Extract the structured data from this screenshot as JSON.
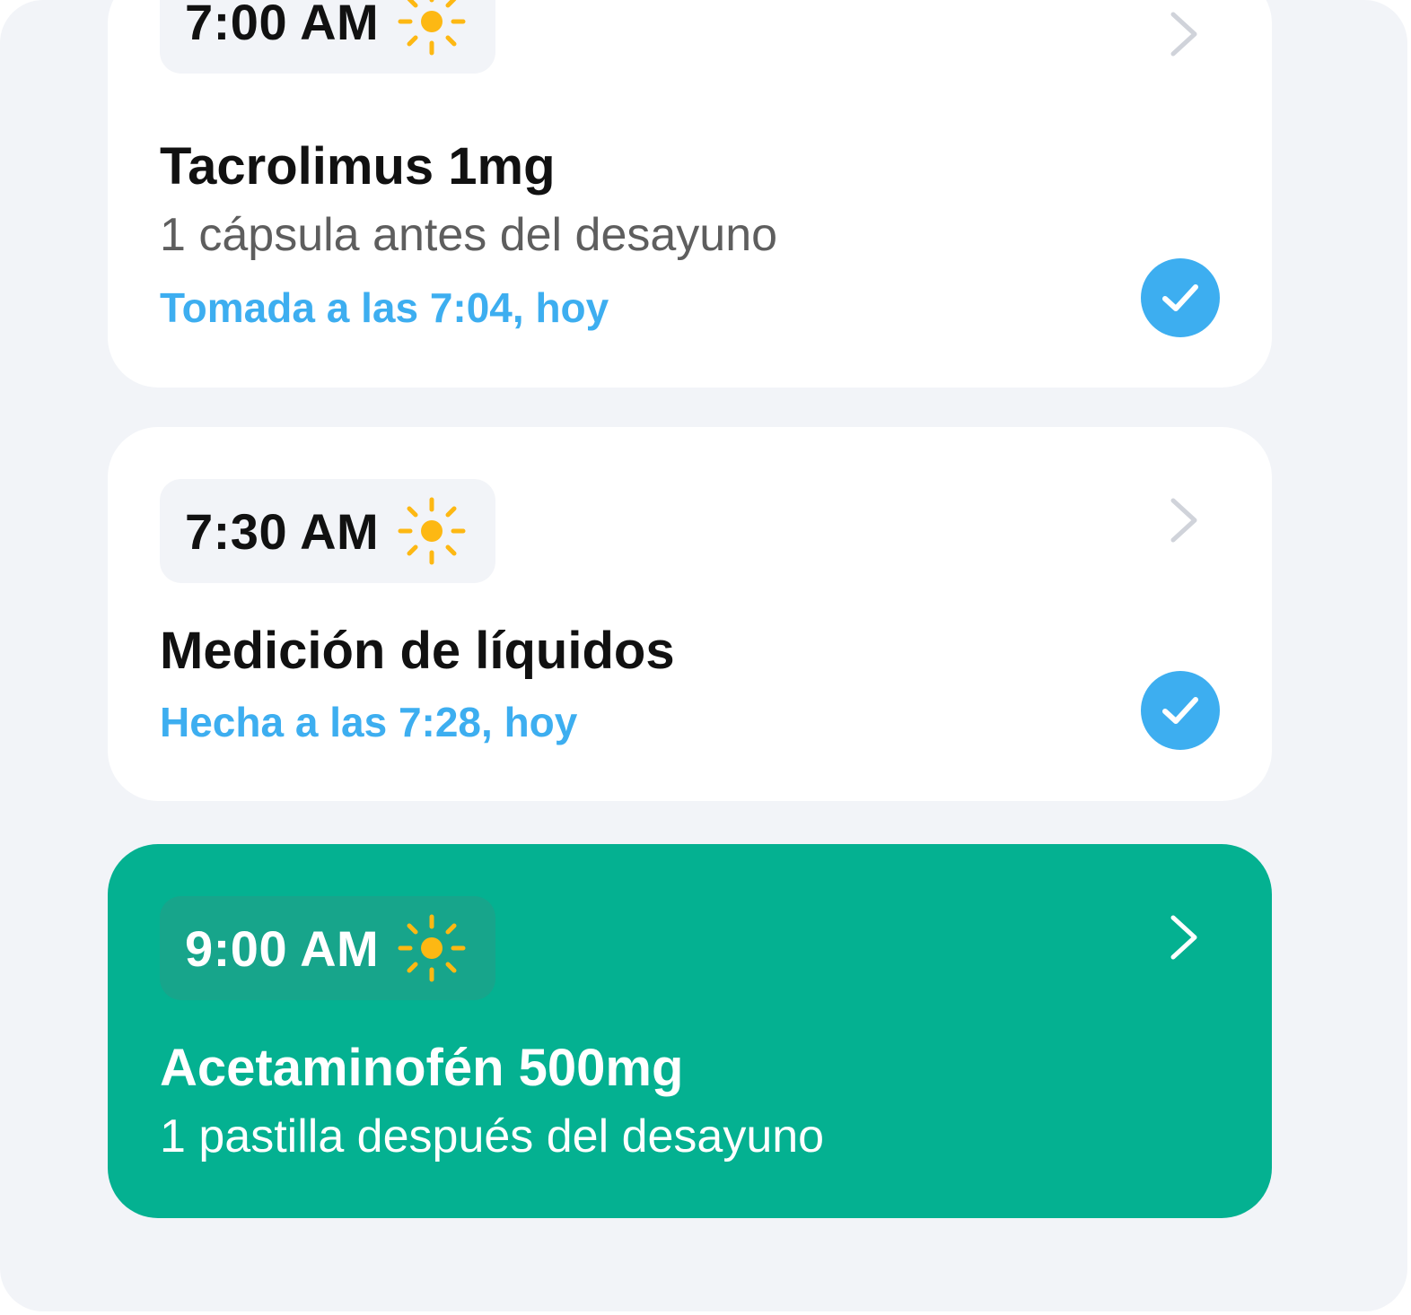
{
  "colors": {
    "background": "#f2f4f8",
    "card": "#ffffff",
    "active_card": "#04b191",
    "accent_blue": "#3daef0",
    "sun": "#fdb813"
  },
  "reminders": [
    {
      "time": "7:00 AM",
      "time_icon": "sun-icon",
      "title": "Tacrolimus 1mg",
      "subtitle": "1 cápsula antes del desayuno",
      "status": "Tomada a las 7:04, hoy",
      "completed": true
    },
    {
      "time": "7:30 AM",
      "time_icon": "sun-icon",
      "title": "Medición de líquidos",
      "status": "Hecha a las 7:28, hoy",
      "completed": true
    },
    {
      "time": "9:00 AM",
      "time_icon": "sun-icon",
      "title": "Acetaminofén 500mg",
      "subtitle": "1 pastilla después del desayuno",
      "completed": false,
      "highlighted": true
    }
  ]
}
